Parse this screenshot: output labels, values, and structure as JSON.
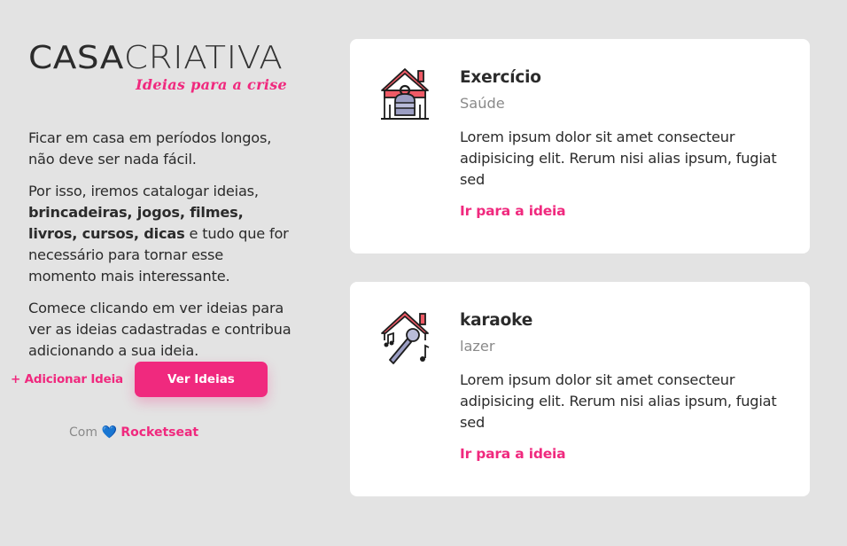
{
  "brand": {
    "logo_part1": "CASA",
    "logo_part2": "CRIATIVA",
    "tagline": "Ideias para a crise",
    "accent_color": "#f0297e"
  },
  "intro": {
    "p1": "Ficar em casa em períodos longos, não deve ser nada fácil.",
    "p2_before": "Por isso, iremos catalogar ideias, ",
    "p2_bold": "brincadeiras, jogos, filmes, livros, cursos, dicas",
    "p2_after": " e tudo que for necessário para tornar esse momento mais interessante.",
    "p3": "Comece clicando em ver ideias para ver as ideias cadastradas e contribua adicionando a sua ideia."
  },
  "actions": {
    "add_label": "+ Adicionar Ideia",
    "view_label": "Ver Ideias"
  },
  "credit": {
    "prefix": "Com",
    "heart_icon": "blue-heart-icon",
    "name": "Rocketseat"
  },
  "ideas": [
    {
      "title": "Exercício",
      "category": "Saúde",
      "description": "Lorem ipsum dolor sit amet consecteur adipisicing elit. Rerum nisi alias ipsum, fugiat sed",
      "link_label": "Ir para a ideia",
      "icon": "house-dumbbell-icon"
    },
    {
      "title": "karaoke",
      "category": "lazer",
      "description": "Lorem ipsum dolor sit amet consecteur adipisicing elit. Rerum nisi alias ipsum, fugiat sed",
      "link_label": "Ir para a ideia",
      "icon": "house-microphone-icon"
    }
  ]
}
